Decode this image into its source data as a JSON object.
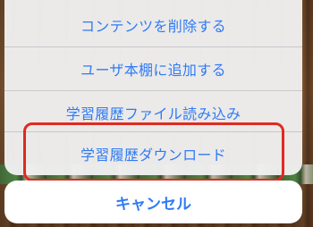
{
  "action_sheet": {
    "items": [
      {
        "label": "コンテンツを削除する"
      },
      {
        "label": "ユーザ本棚に追加する"
      },
      {
        "label": "学習履歴ファイル読み込み"
      },
      {
        "label": "学習履歴ダウンロード"
      }
    ],
    "cancel_label": "キャンセル"
  },
  "colors": {
    "action_text": "#2f7bf5",
    "highlight": "#e02a20",
    "sheet_bg": "#f0f0f0"
  }
}
